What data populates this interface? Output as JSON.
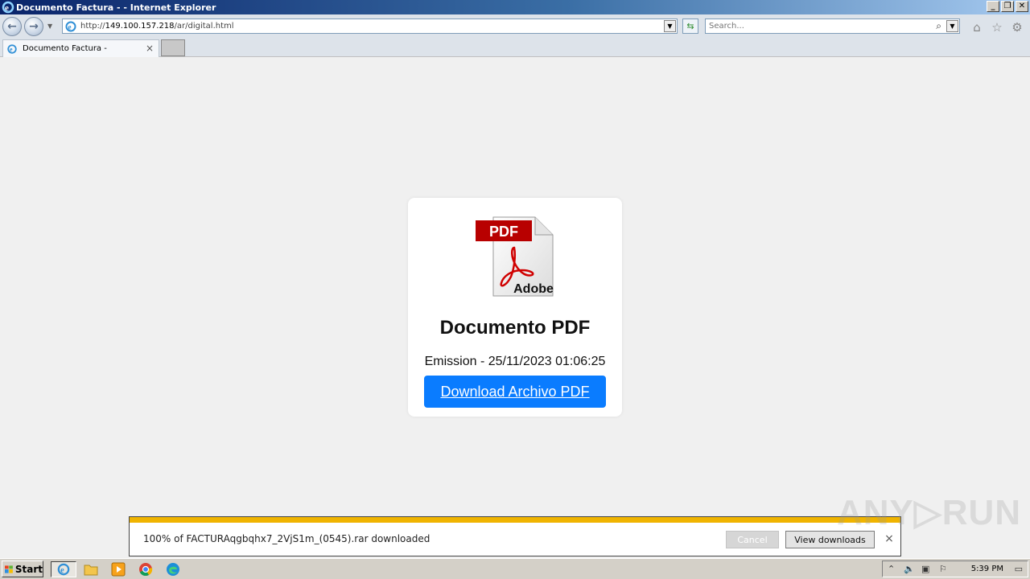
{
  "window": {
    "title": "Documento Factura - - Internet Explorer",
    "controls": [
      "_",
      "❐",
      "✕"
    ]
  },
  "navbar": {
    "url_prefix": "http://",
    "url_host": "149.100.157.218",
    "url_path": "/ar/digital.html",
    "search_placeholder": "Search..."
  },
  "tabs": [
    {
      "label": "Documento Factura -"
    }
  ],
  "card": {
    "icon_label_pdf": "PDF",
    "icon_label_adobe": "Adobe",
    "title": "Documento PDF",
    "emission": "Emission - 25/11/2023 01:06:25",
    "download_button": "Download Archivo PDF"
  },
  "download_bar": {
    "progress": 1.0,
    "message": "100% of FACTURAqgbqhx7_2VjS1m_(0545).rar downloaded",
    "cancel_label": "Cancel",
    "view_label": "View downloads",
    "close_label": "×"
  },
  "watermark": "ANY▷RUN",
  "taskbar": {
    "start_label": "Start",
    "clock": "5:39 PM",
    "pinned": [
      "ie-icon",
      "folder-icon",
      "media-player-icon",
      "chrome-icon",
      "edge-icon"
    ]
  },
  "colors": {
    "accent_button": "#0a7cff",
    "progress": "#f0b400",
    "titlebar_start": "#0a246a"
  }
}
